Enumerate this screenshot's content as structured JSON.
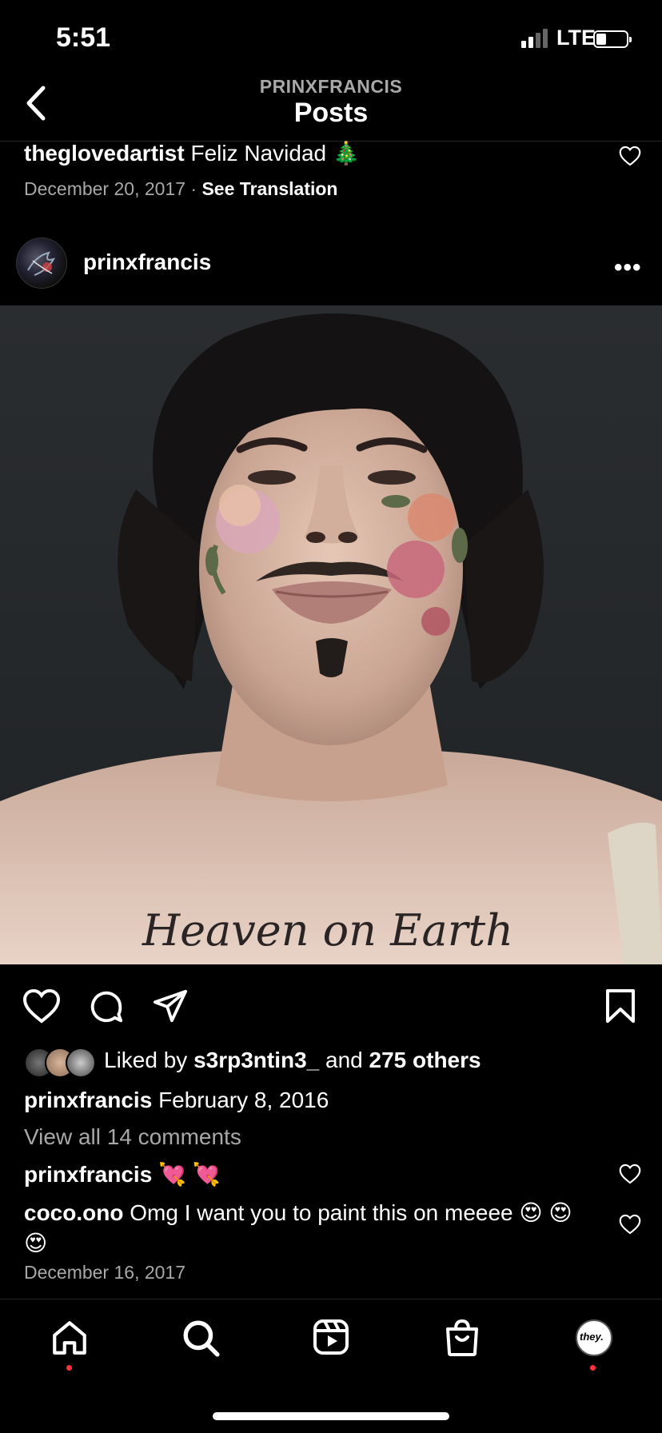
{
  "status_bar": {
    "time": "5:51",
    "network": "LTE"
  },
  "header": {
    "username": "PRINXFRANCIS",
    "title": "Posts"
  },
  "previous_comment": {
    "username": "theglovedartist",
    "text": "Feliz Navidad 🎄",
    "date": "December 20, 2017",
    "separator": "·",
    "translate_link": "See Translation"
  },
  "post": {
    "username": "prinxfrancis",
    "more_label": "•••",
    "image_text": "Heaven on Earth",
    "likes": {
      "prefix": "Liked by",
      "user": "s3rp3ntin3_",
      "middle": "and",
      "others": "275 others"
    },
    "caption": {
      "username": "prinxfrancis",
      "text": "February 8, 2016"
    },
    "view_all_comments": "View all 14 comments",
    "comments": [
      {
        "username": "prinxfrancis",
        "text": "💘 💘"
      },
      {
        "username": "coco.ono",
        "text": "Omg I want you to paint this on meeee 😍 😍 😍"
      }
    ],
    "date": "December 16, 2017"
  },
  "tab_bar": {
    "profile_badge": "they."
  },
  "colors": {
    "background": "#000000",
    "secondary_text": "#a8a8a8",
    "notification_dot": "#ff3040"
  }
}
